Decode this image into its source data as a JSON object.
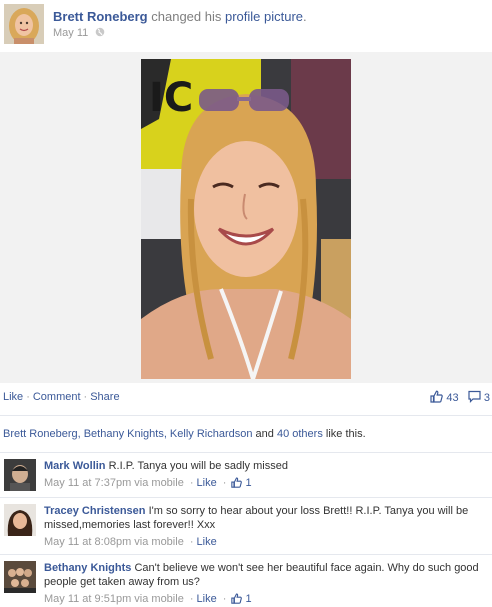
{
  "post": {
    "author": "Brett Roneberg",
    "action_text": "changed his",
    "action_object": "profile picture",
    "action_end": ".",
    "date": "May 11",
    "privacy_icon": "globe-icon"
  },
  "actions": {
    "like": "Like",
    "comment": "Comment",
    "share": "Share",
    "separator": "·",
    "like_count": "43",
    "comment_count": "3"
  },
  "likes": {
    "names": "Brett Roneberg, Bethany Knights, Kelly Richardson",
    "and_text": "and",
    "others_link": "40 others",
    "suffix": "like this."
  },
  "comments": [
    {
      "name": "Mark Wollin",
      "text": "R.I.P. Tanya you will be sadly missed",
      "time": "May 11 at 7:37pm via mobile",
      "like_label": "Like",
      "like_count": "1"
    },
    {
      "name": "Tracey Christensen",
      "text": "I'm so sorry to hear about your loss Brett!! R.I.P. Tanya you will be missed,memories last forever!! Xxx",
      "time": "May 11 at 8:08pm via mobile",
      "like_label": "Like",
      "like_count": ""
    },
    {
      "name": "Bethany Knights",
      "text": "Can't believe we won't see her beautiful face again. Why do such good people get taken away from us?",
      "time": "May 11 at 9:51pm via mobile",
      "like_label": "Like",
      "like_count": "1"
    }
  ],
  "colors": {
    "link": "#3b5998",
    "muted": "#999999",
    "divider": "#e5e8ee"
  }
}
